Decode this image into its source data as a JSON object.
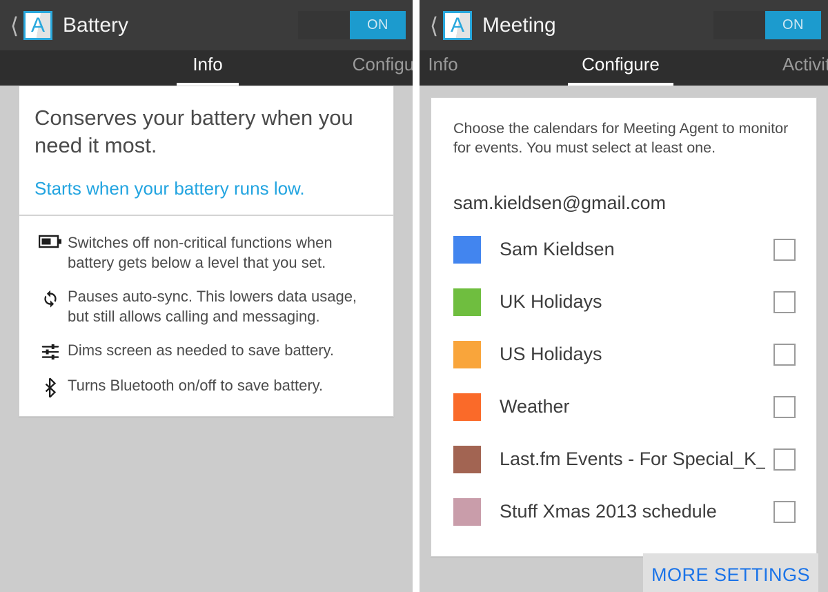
{
  "colors": {
    "accent_blue": "#1c9bce",
    "link_blue": "#22a4e0",
    "titlebar_bg": "#3b3b3b",
    "tabbar_bg": "#2e2e2e",
    "panel_bg": "#cccccc",
    "card_bg": "#ffffff",
    "more_settings_blue": "#1a73e8"
  },
  "left_panel": {
    "titlebar": {
      "back_icon": "back-chevron-icon",
      "app_icon_letter": "A",
      "title": "Battery",
      "toggle_label": "ON",
      "toggle_state": "on"
    },
    "tabs": [
      {
        "label": "Info",
        "active": true
      },
      {
        "label": "Configure",
        "active": false
      }
    ],
    "hero_card": {
      "headline": "Conserves your battery when you need it most.",
      "link": "Starts when your battery runs low."
    },
    "features": [
      {
        "icon": "battery-icon",
        "text": "Switches off non-critical functions when battery gets below a level that you set."
      },
      {
        "icon": "sync-icon",
        "text": "Pauses auto-sync. This lowers data usage, but still allows calling and messaging."
      },
      {
        "icon": "tune-sliders-icon",
        "text": "Dims screen as needed to save battery."
      },
      {
        "icon": "bluetooth-icon",
        "text": "Turns Bluetooth on/off to save battery."
      }
    ]
  },
  "right_panel": {
    "titlebar": {
      "back_icon": "back-chevron-icon",
      "app_icon_letter": "A",
      "title": "Meeting",
      "toggle_label": "ON",
      "toggle_state": "on"
    },
    "tabs": [
      {
        "label": "Info",
        "active": false
      },
      {
        "label": "Configure",
        "active": true
      },
      {
        "label": "Activity",
        "active": false
      }
    ],
    "calendars_card": {
      "intro": "Choose the calendars for Meeting Agent to monitor for events. You must select at least one.",
      "account": "sam.kieldsen@gmail.com",
      "items": [
        {
          "name": "Sam Kieldsen",
          "color": "#4285ef",
          "checked": false
        },
        {
          "name": "UK Holidays",
          "color": "#6fbe3f",
          "checked": false
        },
        {
          "name": "US Holidays",
          "color": "#f9a53b",
          "checked": false
        },
        {
          "name": "Weather",
          "color": "#fa6a29",
          "checked": false
        },
        {
          "name": "Last.fm Events - For Special_K_...",
          "color": "#a26452",
          "checked": false
        },
        {
          "name": "Stuff Xmas 2013 schedule",
          "color": "#c99daa",
          "checked": false
        }
      ]
    },
    "more_settings_label": "MORE SETTINGS"
  }
}
